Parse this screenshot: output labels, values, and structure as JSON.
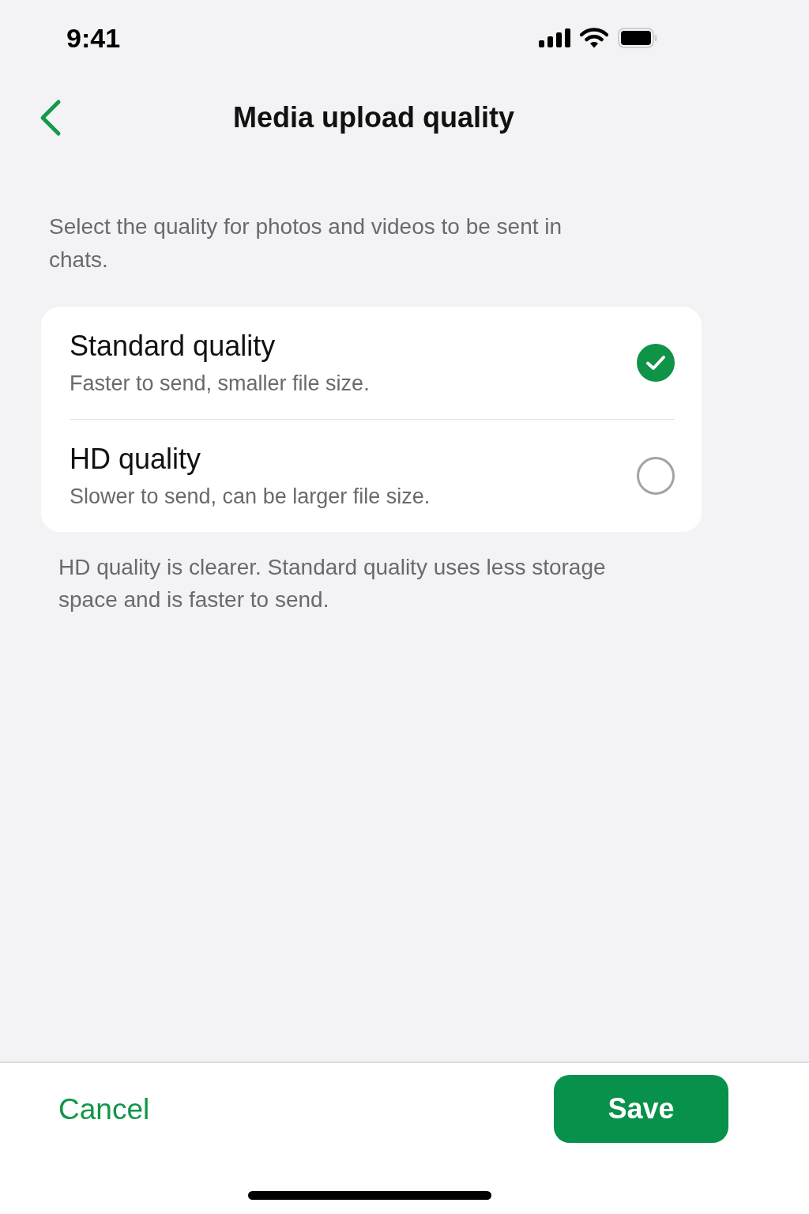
{
  "status_bar": {
    "time": "9:41"
  },
  "nav": {
    "title": "Media upload quality"
  },
  "intro": "Select the quality for photos and videos to be sent in chats.",
  "options": [
    {
      "title": "Standard quality",
      "subtitle": "Faster to send, smaller file size.",
      "selected": true
    },
    {
      "title": "HD quality",
      "subtitle": "Slower to send, can be larger file size.",
      "selected": false
    }
  ],
  "note": "HD quality is clearer. Standard quality uses less storage space and is faster to send.",
  "footer": {
    "cancel": "Cancel",
    "save": "Save"
  }
}
